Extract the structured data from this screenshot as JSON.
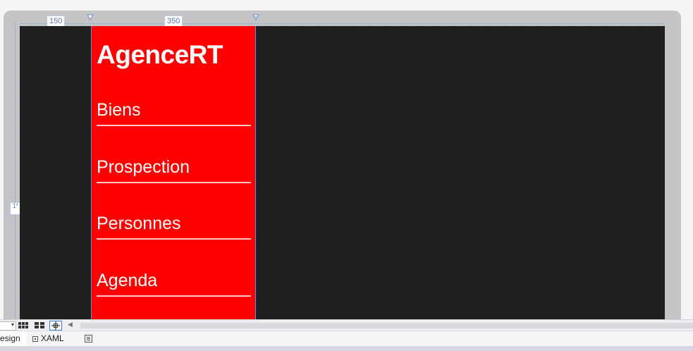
{
  "rulers": {
    "column_1": "150",
    "column_2": "350",
    "row_1": "1*"
  },
  "app": {
    "title": "AgenceRT",
    "nav_items": [
      {
        "label": "Biens"
      },
      {
        "label": "Prospection"
      },
      {
        "label": "Personnes"
      },
      {
        "label": "Agenda"
      }
    ]
  },
  "tabs": {
    "design": "esign",
    "xaml": "XAML"
  },
  "colors": {
    "nav_background": "#ff0000",
    "canvas_background": "#1f1f1f",
    "underline": "#ffc7c7"
  }
}
